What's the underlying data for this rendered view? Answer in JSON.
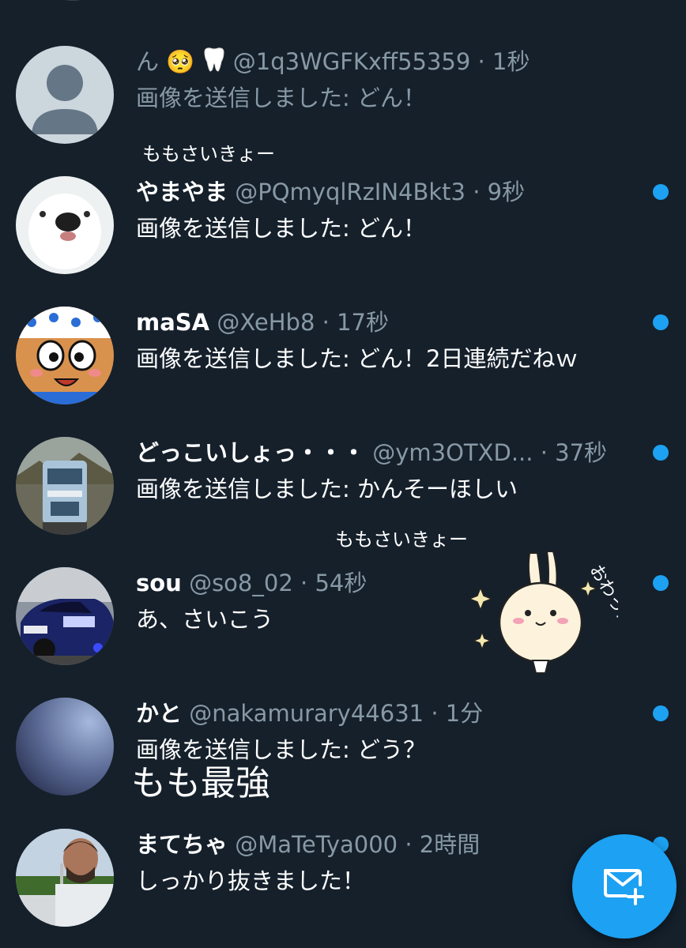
{
  "conversations": [
    {
      "name": "ん",
      "handle": "@1q3WGFKxff55359",
      "sep": " · ",
      "time": "1秒",
      "message": "画像を送信しました: どん！",
      "unread": false
    },
    {
      "name": "やまやま",
      "handle": "@PQmyqlRzIN4Bkt3",
      "sep": " · ",
      "time": "9秒",
      "message": "画像を送信しました: どん！",
      "unread": true
    },
    {
      "name": "maSA",
      "handle": "@XeHb8",
      "sep": " · ",
      "time": "17秒",
      "message": "画像を送信しました: どん！2日連続だねｗ",
      "unread": true
    },
    {
      "name": "どっこいしょっ・・・",
      "handle": "@ym3OTXD...",
      "sep": " · ",
      "time": "37秒",
      "message": "画像を送信しました: かんそーほしい",
      "unread": true
    },
    {
      "name": "sou",
      "handle": "@so8_02",
      "sep": " · ",
      "time": "54秒",
      "message": "あ、さいこう",
      "unread": true
    },
    {
      "name": "かと",
      "handle": "@nakamurary44631",
      "sep": " · ",
      "time": "1分",
      "message": "画像を送信しました: どう？",
      "unread": true
    },
    {
      "name": "まてちゃ",
      "handle": "@MaTeTya000",
      "sep": " · ",
      "time": "2時間",
      "message": "しっかり抜きました！",
      "unread": true
    }
  ],
  "overlays": {
    "caption_1": "ももさいきょー",
    "caption_2": "ももさいきょー",
    "big_text": "もも最強",
    "sticker_text": "おわった!!"
  },
  "fab": {
    "icon": "new-message-icon"
  },
  "colors": {
    "background": "#15202b",
    "accent": "#1da1f2",
    "secondary_text": "#8899a6"
  }
}
